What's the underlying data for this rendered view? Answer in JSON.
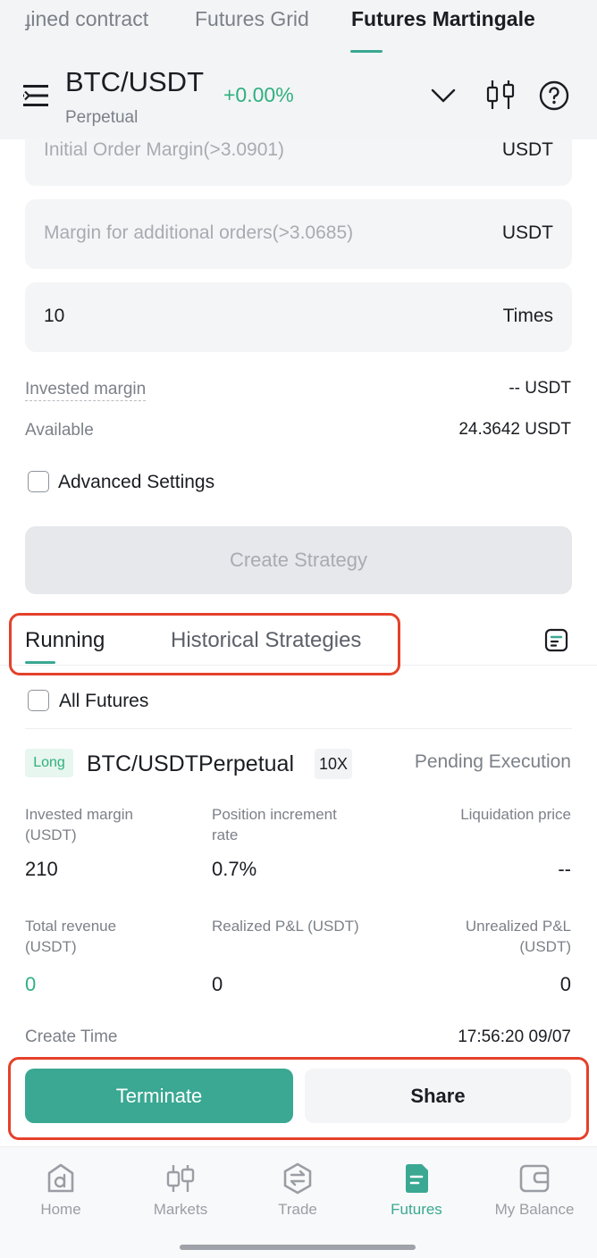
{
  "top_tabs": [
    {
      "label": "ɟined contract"
    },
    {
      "label": "Futures Grid"
    },
    {
      "label": "Futures Martingale"
    }
  ],
  "header": {
    "pair": "BTC/USDT",
    "change": "+0.00%",
    "contract_type": "Perpetual",
    "icons": [
      "menu-icon",
      "chevron-down-icon",
      "candlestick-icon",
      "help-icon"
    ]
  },
  "form": {
    "initial_margin": {
      "placeholder": "Initial Order Margin(>3.0901)",
      "unit": "USDT"
    },
    "additional_margin": {
      "placeholder": "Margin for additional orders(>3.0685)",
      "unit": "USDT"
    },
    "times": {
      "value": "10",
      "unit": "Times"
    },
    "invested_margin": {
      "label": "Invested margin",
      "value": "-- USDT"
    },
    "available": {
      "label": "Available",
      "value": "24.3642 USDT"
    },
    "advanced_settings": "Advanced Settings",
    "create_button": "Create Strategy"
  },
  "strategy_tabs": {
    "running": "Running",
    "historical": "Historical Strategies"
  },
  "filter": {
    "all_futures": "All Futures"
  },
  "card": {
    "side": "Long",
    "pair": "BTC/USDTPerpetual",
    "leverage": "10X",
    "status": "Pending Execution",
    "invested_margin_label_1": "Invested margin",
    "invested_margin_label_2": "(USDT)",
    "invested_margin": "210",
    "increment_label_1": "Position increment",
    "increment_label_2": "rate",
    "increment": "0.7%",
    "liquidation_label": "Liquidation price",
    "liquidation": "--",
    "total_revenue_label_1": "Total revenue",
    "total_revenue_label_2": "(USDT)",
    "total_revenue": "0",
    "realized_label": "Realized P&L (USDT)",
    "realized": "0",
    "unrealized_label_1": "Unrealized P&L",
    "unrealized_label_2": "(USDT)",
    "unrealized": "0",
    "create_time_label": "Create Time",
    "create_time": "17:56:20 09/07"
  },
  "actions": {
    "terminate": "Terminate",
    "share": "Share"
  },
  "bottom_nav": [
    {
      "label": "Home",
      "icon": "home-icon"
    },
    {
      "label": "Markets",
      "icon": "markets-icon"
    },
    {
      "label": "Trade",
      "icon": "trade-icon"
    },
    {
      "label": "Futures",
      "icon": "futures-icon",
      "active": true
    },
    {
      "label": "My Balance",
      "icon": "wallet-icon"
    }
  ],
  "colors": {
    "accent": "#3aa892",
    "positive": "#2fb07f",
    "highlight_box": "#e4412b"
  }
}
